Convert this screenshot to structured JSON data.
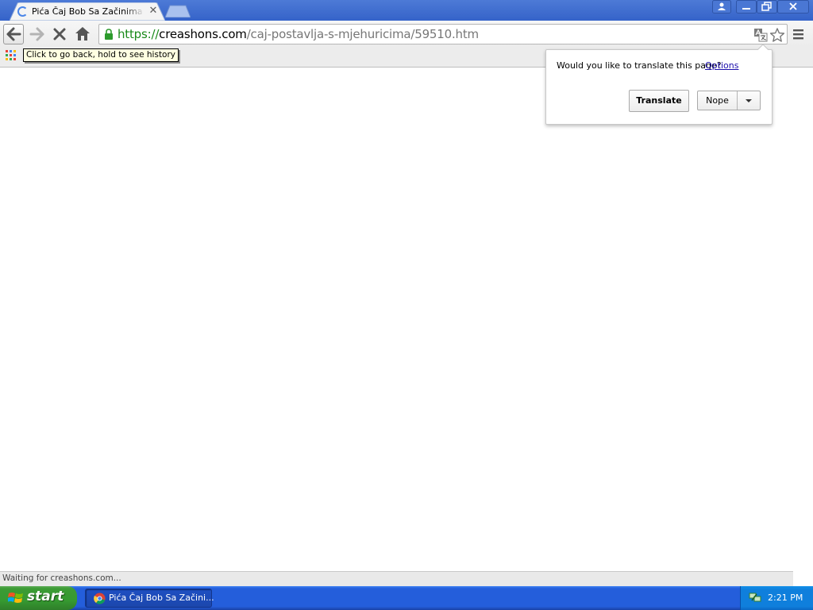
{
  "browser": {
    "tab": {
      "title": "Pića Čaj Bob Sa Začinima Tea",
      "close_label": "✕",
      "loading": true
    },
    "window_controls": [
      "user-icon",
      "minimize-icon",
      "restore-icon",
      "close-icon"
    ],
    "toolbar": {
      "url_scheme": "https://",
      "url_host": "creashons.com",
      "url_path": "/caj-postavlja-s-mjehuricima/59510.htm",
      "icons": [
        "back-arrow-icon",
        "forward-arrow-icon",
        "stop-icon",
        "home-icon",
        "lock-icon",
        "translate-icon",
        "star-icon",
        "menu-icon"
      ]
    },
    "bookmarks_bar": {
      "tooltip": "Click to go back, hold to see history"
    },
    "translate_bubble": {
      "question": "Would you like to translate this page?",
      "options_link": "Options",
      "translate_button": "Translate",
      "nope_button": "Nope"
    },
    "status": "Waiting for creashons.com..."
  },
  "taskbar": {
    "start_label": "start",
    "task_item": "Pića Čaj Bob Sa Začini...",
    "clock": "2:21 PM"
  },
  "colors": {
    "secure_green": "#1a8a1a",
    "link_blue": "#1a0dab",
    "taskbar_blue": "#245edb",
    "start_green": "#369a31"
  }
}
